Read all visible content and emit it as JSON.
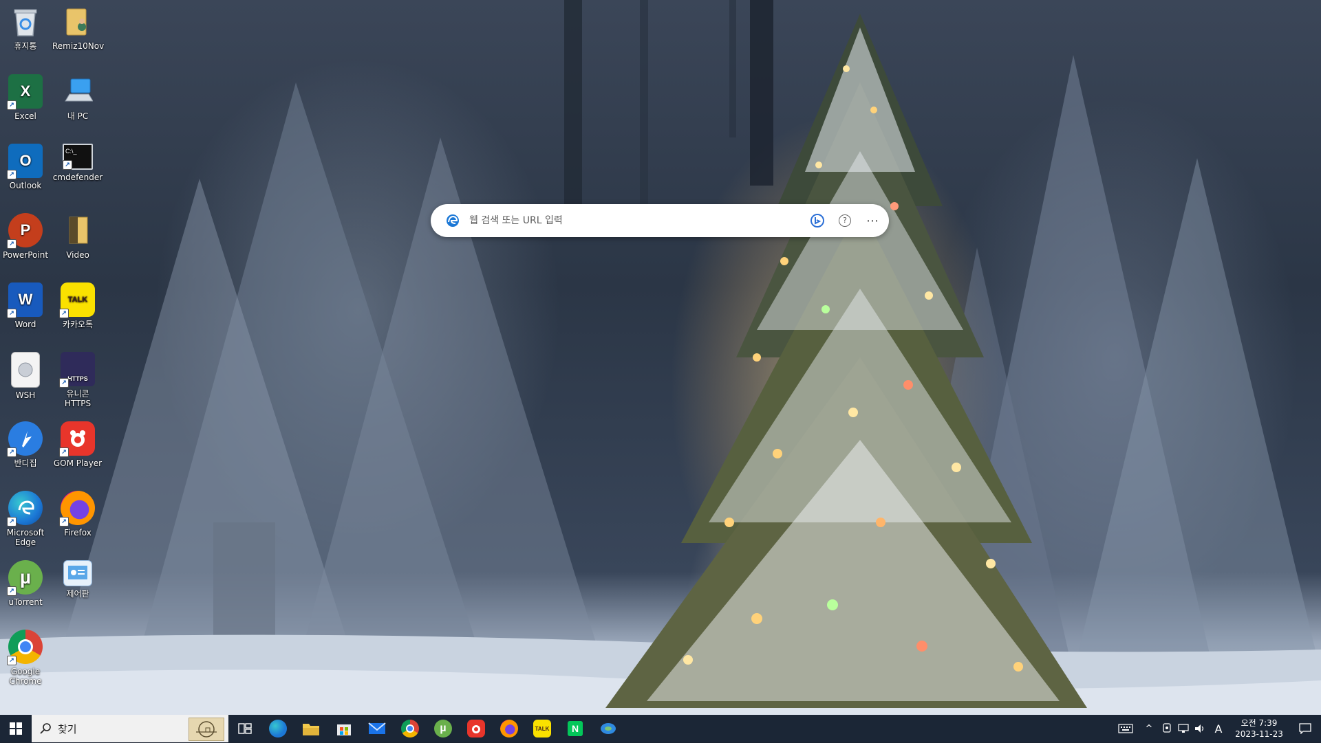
{
  "desktop": {
    "icons": [
      {
        "label": "휴지통",
        "icon": "recycle-bin-icon"
      },
      {
        "label": "Remiz10Nov",
        "icon": "user-folder-icon"
      },
      {
        "label": "Excel",
        "icon": "excel-icon"
      },
      {
        "label": "내 PC",
        "icon": "this-pc-icon"
      },
      {
        "label": "Outlook",
        "icon": "outlook-icon"
      },
      {
        "label": "cmdefender",
        "icon": "cmd-icon"
      },
      {
        "label": "PowerPoint",
        "icon": "powerpoint-icon"
      },
      {
        "label": "Video",
        "icon": "video-folder-icon"
      },
      {
        "label": "Word",
        "icon": "word-icon"
      },
      {
        "label": "카카오톡",
        "icon": "kakaotalk-icon"
      },
      {
        "label": "WSH",
        "icon": "wsh-script-icon"
      },
      {
        "label": "유니콘 HTTPS",
        "icon": "unicorn-https-icon"
      },
      {
        "label": "반디집",
        "icon": "bandizip-icon"
      },
      {
        "label": "GOM Player",
        "icon": "gom-player-icon"
      },
      {
        "label": "Microsoft Edge",
        "icon": "edge-icon"
      },
      {
        "label": "Firefox",
        "icon": "firefox-icon"
      },
      {
        "label": "uTorrent",
        "icon": "utorrent-icon"
      },
      {
        "label": "제어판",
        "icon": "control-panel-icon"
      },
      {
        "label": "Google Chrome",
        "icon": "chrome-icon"
      }
    ],
    "icon_glyphs": {
      "excel": "X",
      "outlook": "O",
      "powerpoint": "P",
      "word": "W",
      "kakaotalk": "TALK",
      "cmd": "C:\\_",
      "https": "HTTPS",
      "utorrent": "µ"
    }
  },
  "search_widget": {
    "placeholder": "웹 검색 또는 URL 입력",
    "icons": [
      "edge-icon",
      "bing-chat-icon",
      "help-icon",
      "more-options-icon"
    ],
    "help_glyph": "?",
    "more_glyph": "⋯"
  },
  "taskbar": {
    "search_placeholder": "찾기",
    "pinned": [
      {
        "name": "task-view",
        "icon": "task-view-icon"
      },
      {
        "name": "edge",
        "icon": "edge-icon"
      },
      {
        "name": "file-explorer",
        "icon": "folder-icon"
      },
      {
        "name": "microsoft-store",
        "icon": "store-icon"
      },
      {
        "name": "mail",
        "icon": "mail-icon"
      },
      {
        "name": "chrome",
        "icon": "chrome-icon"
      },
      {
        "name": "utorrent",
        "icon": "utorrent-icon"
      },
      {
        "name": "gom-player",
        "icon": "gom-player-icon"
      },
      {
        "name": "firefox",
        "icon": "firefox-icon"
      },
      {
        "name": "kakaotalk",
        "icon": "kakaotalk-icon"
      },
      {
        "name": "naver",
        "icon": "naver-icon"
      },
      {
        "name": "edge-legacy",
        "icon": "edge-legacy-icon"
      }
    ],
    "pinned_glyphs": {
      "naver": "N",
      "kakaotalk": "TALK",
      "utorrent": "µ"
    },
    "tray": {
      "ime_label": "A",
      "time": "오전 7:39",
      "date": "2023-11-23",
      "chevron_glyph": "^"
    }
  },
  "colors": {
    "taskbar_bg": "#1b2636",
    "search_widget_bg": "#ffffff",
    "excel": "#1d7044",
    "outlook": "#0f6cbd",
    "powerpoint": "#c43e1c",
    "word": "#185abd",
    "kakaotalk": "#fae100",
    "bandizip": "#2a7de1",
    "gom": "#e8352b",
    "utorrent": "#6ab04c"
  }
}
